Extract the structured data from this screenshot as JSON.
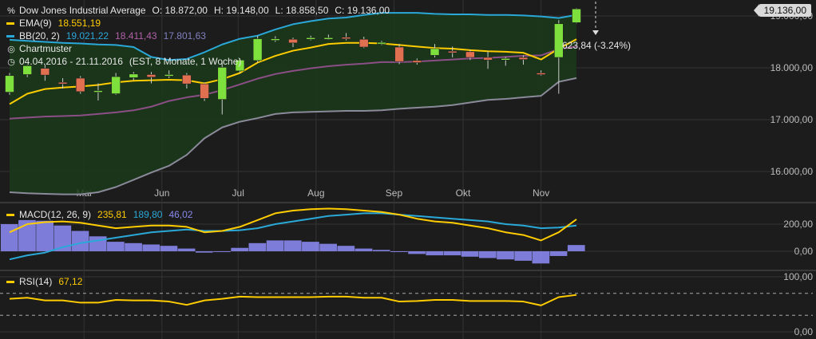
{
  "instrument": {
    "name": "Dow Jones Industrial Average",
    "open": "O: 18.872,00",
    "high": "H: 19.148,00",
    "low": "L: 18.858,50",
    "close": "C: 19.136,00",
    "icon": "ohlc-candles-icon"
  },
  "legend": {
    "ema_label": "EMA(9)",
    "ema_value": "18.551,19",
    "bb_label": "BB(20, 2)",
    "bb_mid": "19.021,22",
    "bb_upper": "18.411,43",
    "bb_lower": "17.801,63",
    "pattern_label": "Chartmuster",
    "range_label": "04.04.2016 - 21.11.2016",
    "range_detail": "(EST, 8 Monate, 1 Woche)",
    "macd_label": "MACD(12, 26, 9)",
    "macd_value": "235,81",
    "macd_signal": "189,80",
    "macd_hist": "46,02",
    "rsi_label": "RSI(14)",
    "rsi_value": "67,12"
  },
  "price_tag": "19.136,00",
  "change_label": "623,84 (-3.24%)",
  "colors": {
    "background": "#1c1c1c",
    "grid": "#333333",
    "up": "#7de03c",
    "down": "#e07050",
    "ema": "#ffcc00",
    "bb_upper_mid": "#2aa8d8",
    "bb_band": "#8b4f86",
    "bb_lower": "#8a8a9a",
    "band_fill": "#1a3a1a",
    "macd": "#ffcc00",
    "macd_signal": "#2aa8d8",
    "macd_hist": "#8888ee",
    "rsi": "#ffcc00"
  },
  "chart_data": [
    {
      "type": "candlestick",
      "title": "Dow Jones Industrial Average",
      "x": [
        "2016-04-04",
        "2016-04-11",
        "2016-04-18",
        "2016-04-25",
        "2016-05-02",
        "2016-05-09",
        "2016-05-16",
        "2016-05-23",
        "2016-05-30",
        "2016-06-06",
        "2016-06-13",
        "2016-06-20",
        "2016-06-27",
        "2016-07-04",
        "2016-07-11",
        "2016-07-18",
        "2016-07-25",
        "2016-08-01",
        "2016-08-08",
        "2016-08-15",
        "2016-08-22",
        "2016-08-29",
        "2016-09-05",
        "2016-09-12",
        "2016-09-19",
        "2016-09-26",
        "2016-10-03",
        "2016-10-10",
        "2016-10-17",
        "2016-10-24",
        "2016-10-31",
        "2016-11-07",
        "2016-11-14"
      ],
      "x_tick_labels": [
        "Mai",
        "Jun",
        "Jul",
        "Aug",
        "Sep",
        "Okt",
        "Nov"
      ],
      "y_tick_labels": [
        "16.000,00",
        "17.000,00",
        "18.000,00",
        "19.000,00"
      ],
      "ylim": [
        15600,
        19500
      ],
      "open": [
        17530,
        17870,
        17990,
        17720,
        17800,
        17540,
        17500,
        17810,
        17870,
        17870,
        17860,
        17690,
        17390,
        17940,
        18140,
        18530,
        18550,
        18550,
        18560,
        18590,
        18550,
        18480,
        18400,
        18140,
        18240,
        18320,
        18310,
        18200,
        18170,
        18200,
        17900,
        18200,
        18872
      ],
      "close": [
        17850,
        18040,
        17860,
        17700,
        17540,
        17560,
        17830,
        17880,
        17820,
        17870,
        17690,
        17410,
        18010,
        18150,
        18560,
        18560,
        18480,
        18580,
        18580,
        18580,
        18400,
        18490,
        18120,
        18100,
        18370,
        18310,
        18200,
        18150,
        18180,
        18160,
        17880,
        18850,
        19136
      ],
      "high": [
        17900,
        18050,
        18060,
        17800,
        17840,
        17700,
        17900,
        17920,
        17920,
        17950,
        17900,
        17720,
        18100,
        18180,
        18620,
        18610,
        18580,
        18620,
        18640,
        18670,
        18600,
        18520,
        18460,
        18180,
        18460,
        18410,
        18350,
        18320,
        18210,
        18240,
        17950,
        18920,
        19148
      ],
      "low": [
        17480,
        17820,
        17750,
        17600,
        17500,
        17370,
        17480,
        17760,
        17700,
        17800,
        17600,
        17360,
        17100,
        17900,
        18100,
        18500,
        18400,
        18530,
        18540,
        18530,
        18380,
        18440,
        18070,
        18060,
        18200,
        18200,
        18150,
        17980,
        18040,
        18060,
        17850,
        17500,
        18858
      ],
      "ema9": [
        17300,
        17500,
        17590,
        17620,
        17640,
        17670,
        17720,
        17750,
        17760,
        17770,
        17760,
        17700,
        17780,
        17900,
        18100,
        18230,
        18330,
        18390,
        18460,
        18480,
        18480,
        18470,
        18440,
        18410,
        18380,
        18370,
        18340,
        18320,
        18310,
        18290,
        18160,
        18370,
        18551
      ],
      "bb_upper": [
        18540,
        18520,
        18500,
        18480,
        18470,
        18450,
        18440,
        18400,
        18210,
        18150,
        18170,
        18300,
        18450,
        18560,
        18620,
        18740,
        18840,
        18900,
        18950,
        18970,
        19020,
        19060,
        19060,
        19060,
        19040,
        19030,
        19030,
        19020,
        19020,
        19010,
        18990,
        18960,
        19021
      ],
      "bb_mid": [
        17020,
        17040,
        17060,
        17070,
        17080,
        17110,
        17140,
        17180,
        17250,
        17360,
        17430,
        17480,
        17570,
        17680,
        17790,
        17880,
        17940,
        17990,
        18030,
        18060,
        18080,
        18110,
        18110,
        18120,
        18140,
        18160,
        18180,
        18190,
        18210,
        18230,
        18240,
        18360,
        18411
      ],
      "bb_lower": [
        15600,
        15580,
        15570,
        15560,
        15560,
        15600,
        15700,
        15840,
        15980,
        16110,
        16320,
        16640,
        16850,
        16960,
        17030,
        17110,
        17140,
        17150,
        17160,
        17170,
        17170,
        17180,
        17210,
        17230,
        17250,
        17280,
        17330,
        17380,
        17400,
        17430,
        17460,
        17730,
        17802
      ],
      "series_names": [
        "EMA(9)",
        "BB(20, 2)"
      ]
    },
    {
      "type": "line",
      "title": "MACD(12, 26, 9)",
      "y_tick_labels": [
        "0,00",
        "200,00"
      ],
      "ylim": [
        -120,
        300
      ],
      "macd": [
        140,
        200,
        215,
        220,
        210,
        190,
        170,
        180,
        190,
        190,
        180,
        140,
        150,
        180,
        230,
        280,
        300,
        310,
        315,
        310,
        300,
        290,
        270,
        240,
        220,
        210,
        190,
        170,
        140,
        120,
        80,
        140,
        235.81
      ],
      "signal": [
        -60,
        -30,
        -10,
        30,
        60,
        80,
        100,
        120,
        140,
        150,
        160,
        150,
        150,
        155,
        170,
        200,
        220,
        240,
        260,
        270,
        280,
        280,
        270,
        260,
        250,
        240,
        230,
        220,
        200,
        190,
        170,
        175,
        189.8
      ],
      "hist": [
        200,
        230,
        225,
        190,
        150,
        110,
        70,
        60,
        50,
        40,
        20,
        -10,
        0,
        25,
        60,
        80,
        80,
        70,
        55,
        40,
        20,
        10,
        0,
        -20,
        -30,
        -30,
        -40,
        -50,
        -60,
        -70,
        -90,
        -35,
        46.02
      ]
    },
    {
      "type": "line",
      "title": "RSI(14)",
      "y_tick_labels": [
        "0,00",
        "100,00"
      ],
      "ylim": [
        0,
        100
      ],
      "rsi": [
        60,
        62,
        57,
        57,
        53,
        53,
        58,
        57,
        57,
        55,
        49,
        57,
        60,
        64,
        63,
        63,
        63,
        63,
        64,
        64,
        62,
        62,
        55,
        56,
        58,
        58,
        56,
        56,
        56,
        55,
        48,
        63,
        67.12
      ]
    }
  ]
}
